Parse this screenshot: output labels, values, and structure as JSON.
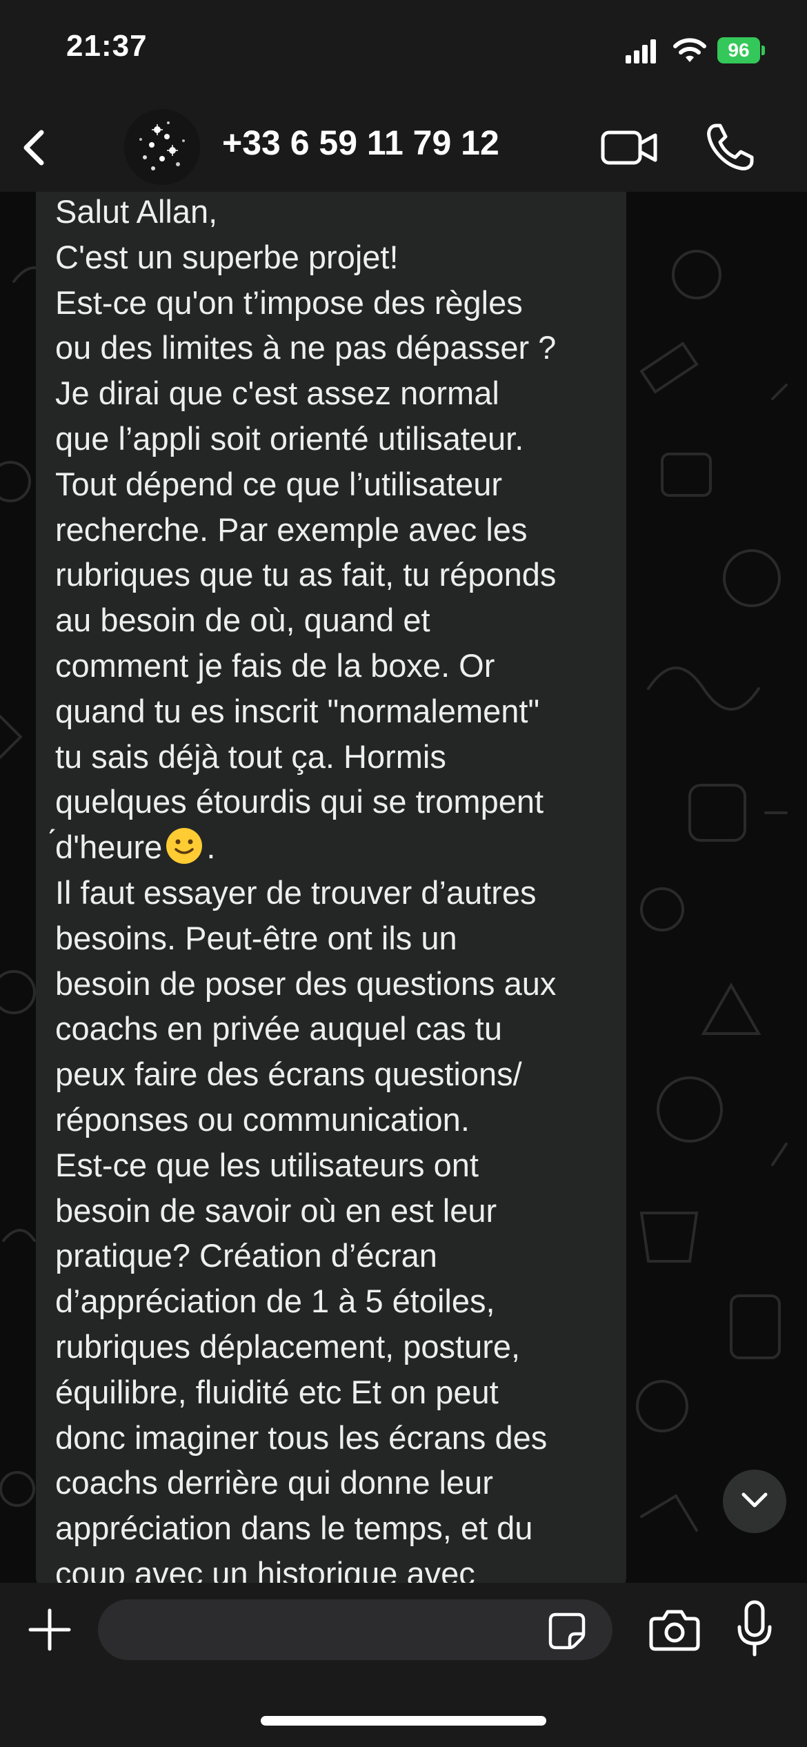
{
  "status_bar": {
    "time": "21:37",
    "battery_level": "96",
    "battery_color": "#34c759",
    "icons": [
      "signal-icon",
      "wifi-icon",
      "battery-charging-icon"
    ]
  },
  "header": {
    "contact_name": "+33 6 59 11 79 12",
    "icons": [
      "chevron-left-icon",
      "video-camera-icon",
      "phone-icon"
    ]
  },
  "message": {
    "lines": [
      "Salut Allan,",
      "C'est un superbe projet!",
      "Est-ce qu'on t’impose des règles",
      "ou des limites à ne pas dépasser ?",
      "Je dirai que c'est assez normal",
      "que l’appli soit orienté utilisateur.",
      "Tout dépend ce que l’utilisateur",
      "recherche. Par exemple avec les",
      "rubriques que tu as fait, tu réponds",
      "au besoin de où, quand et",
      "comment je fais de la boxe. Or",
      "quand tu es inscrit \"normalement\"",
      "tu sais déjà tout ça. Hormis",
      "quelques étourdis qui se trompent",
      "́d'heure",
      "Il faut essayer de trouver d’autres",
      "besoins. Peut-être ont ils un",
      "besoin de poser des questions aux",
      "coachs en privée auquel cas tu",
      "peux faire des écrans questions/",
      "réponses ou communication.",
      "Est-ce que les utilisateurs ont",
      "besoin de savoir où en est leur",
      "pratique? Création d’écran",
      "d’appréciation de 1 à 5 étoiles,",
      "rubriques déplacement, posture,",
      "équilibre, fluidité etc Et on peut",
      "donc imaginer tous les écrans des",
      "coachs derrière qui donne leur",
      "appréciation dans le temps, et du",
      "coup avec un historique avec"
    ],
    "emoji_after_line_15": ".",
    "emoji_name": "slightly-smiling-face-emoji"
  },
  "composer": {
    "input_value": "",
    "icons": [
      "plus-icon",
      "sticker-icon",
      "camera-icon",
      "microphone-icon"
    ]
  },
  "colors": {
    "header_bg": "#1a1a1a",
    "chat_bg": "#0c0c0c",
    "bubble_bg": "#242626",
    "text": "#eeeeee"
  }
}
